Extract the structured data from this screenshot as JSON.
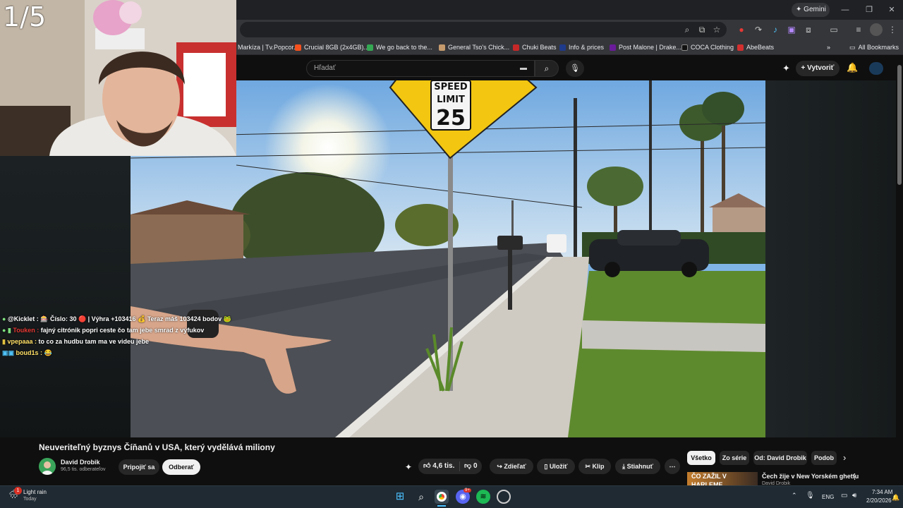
{
  "stream": {
    "counter": "1/5",
    "chat": [
      {
        "user": "@Kicklet :",
        "text": " 🎰 Číslo: 30 🔴 | Výhra +103416 💰 Teraz máš 103424 bodov 🐸"
      },
      {
        "user": "Touken :",
        "text": " fajný citrónik popri ceste čo tam jebe smrad z výfukov"
      },
      {
        "user": "vpepaaa :",
        "text": " to co za hudbu tam ma ve videu jebe"
      },
      {
        "user": "boud1s :",
        "text": " 😂"
      }
    ]
  },
  "browser": {
    "gemini_label": "Gemini",
    "bookmarks": [
      {
        "label": "Markíza | Tv.Popcor...",
        "color": "#e53935"
      },
      {
        "label": "Crucial 8GB (2x4GB)...",
        "color": "#f4511e"
      },
      {
        "label": "We go back to the...",
        "color": "#34a853"
      },
      {
        "label": "General Tso's Chick...",
        "color": "#c59b6d"
      },
      {
        "label": "Chuki Beats",
        "color": "#c62828"
      },
      {
        "label": "Info & prices",
        "color": "#1e3a8a"
      },
      {
        "label": "Post Malone | Drake...",
        "color": "#6a1b9a"
      },
      {
        "label": "COCA Clothing",
        "color": "#111111"
      },
      {
        "label": "AbeBeats",
        "color": "#d32f2f"
      }
    ],
    "all_bookmarks": "All Bookmarks"
  },
  "youtube": {
    "search_placeholder": "Hľadať",
    "create_label": "Vytvoriť",
    "video": {
      "sign_top": "SPEED",
      "sign_mid": "LIMIT",
      "sign_num": "25"
    },
    "title": "Neuveriteľný byznys Číňanů v USA, který vydělává miliony",
    "channel": "David Drobik",
    "subscribers": "96,5 tis. odberateľov",
    "join_label": "Pripojiť sa",
    "subscribe_label": "Odberať",
    "likes": "4,6 tis.",
    "dislikes": "0",
    "share_label": "Zdieľať",
    "save_label": "Uložiť",
    "clip_label": "Klip",
    "download_label": "Stiahnuť",
    "more_label": "⋯",
    "chips": [
      "Všetko",
      "Zo série",
      "Od: David Drobik",
      "Podob"
    ],
    "recommended": {
      "thumb_text": "ČO ZAŽIL V HARLEME",
      "title": "Čech žije v New Yorském ghettu",
      "channel": "David Drobik"
    }
  },
  "taskbar": {
    "weather": "Light rain",
    "weather_sub": "Today",
    "weather_badge": "1",
    "lang": "ENG",
    "time": "7:34 AM",
    "date": "2/20/2026",
    "discord_badge": "9+"
  }
}
